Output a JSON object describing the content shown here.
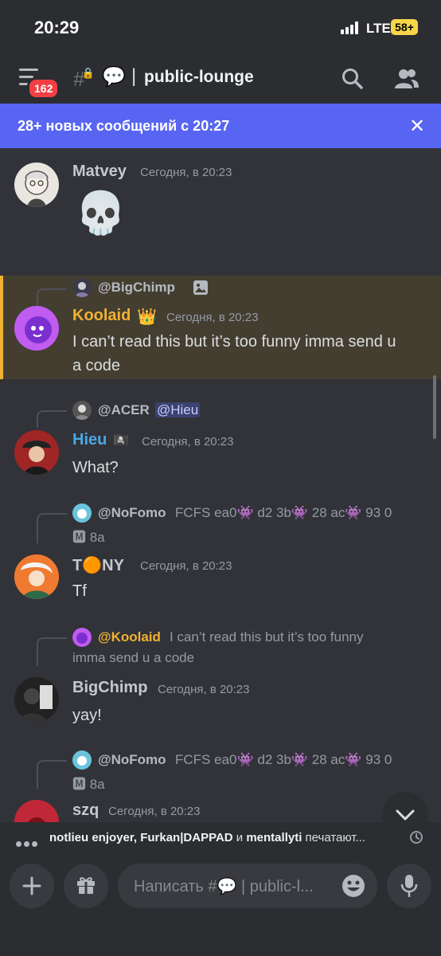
{
  "status_bar": {
    "time": "20:29",
    "network": "LTE",
    "battery": "58+"
  },
  "header": {
    "unread_badge": "162",
    "channel_emoji": "💬",
    "channel_name": "public-lounge",
    "icons": [
      "menu-icon",
      "hash-lock-icon",
      "search-icon",
      "members-icon"
    ]
  },
  "banner": {
    "text": "28+ новых сообщений с 20:27",
    "close_label": "✕"
  },
  "messages": [
    {
      "user": "Matvey",
      "time": "Сегодня, в 20:23",
      "content": "💀",
      "name_color": "#c4c9ce"
    },
    {
      "reply": {
        "user": "@BigChimp",
        "attachment_icon": "image-icon"
      },
      "user": "Koolaid",
      "badge": "👑",
      "time": "Сегодня, в 20:23",
      "lines": [
        "I can’t read this but it’s too funny imma send u",
        "a code"
      ],
      "name_color": "#f0b232",
      "highlighted": true
    },
    {
      "reply": {
        "user": "@ACER",
        "mention": "@Hieu"
      },
      "user": "Hieu",
      "badge": "🏴‍☠️",
      "time": "Сегодня, в 20:23",
      "content": "What?",
      "name_color": "#4aa8e8"
    },
    {
      "reply": {
        "user": "@NoFomo",
        "text_line1": "FCFS  ea0👾  d2 3b👾  28 ac👾 93 0",
        "text_line2": "🅼 8a"
      },
      "user_prefix": "T",
      "user_emoji": "🟠",
      "user_suffix": "NY",
      "time": "Сегодня, в 20:23",
      "content": "Tf",
      "name_color": "#c4c9ce"
    },
    {
      "reply": {
        "user": "@Koolaid",
        "text_line1": "I can’t read this but it’s too funny",
        "text_line2": "imma send u a code"
      },
      "user": "BigChimp",
      "time": "Сегодня, в 20:23",
      "content": "yay!",
      "name_color": "#c4c9ce"
    },
    {
      "reply": {
        "user": "@NoFomo",
        "text_line1": "FCFS  ea0👾  d2 3b👾  28 ac👾 93 0",
        "text_line2": "🅼 8a"
      },
      "user": "szq",
      "time": "Сегодня, в 20:23",
      "name_color": "#c4c9ce"
    }
  ],
  "typing": {
    "names": "notlieu enjoyer, Furkan|DAPPAD",
    "conj": " и ",
    "last": "mentallyti",
    "suffix": " печатают..."
  },
  "composer": {
    "placeholder": "Написать #💬 | public-l..."
  },
  "colors": {
    "accent": "#5865f2",
    "background": "#313338",
    "highlight": "#443e31",
    "highlight_border": "#f0b232",
    "badge": "#f23f43"
  }
}
